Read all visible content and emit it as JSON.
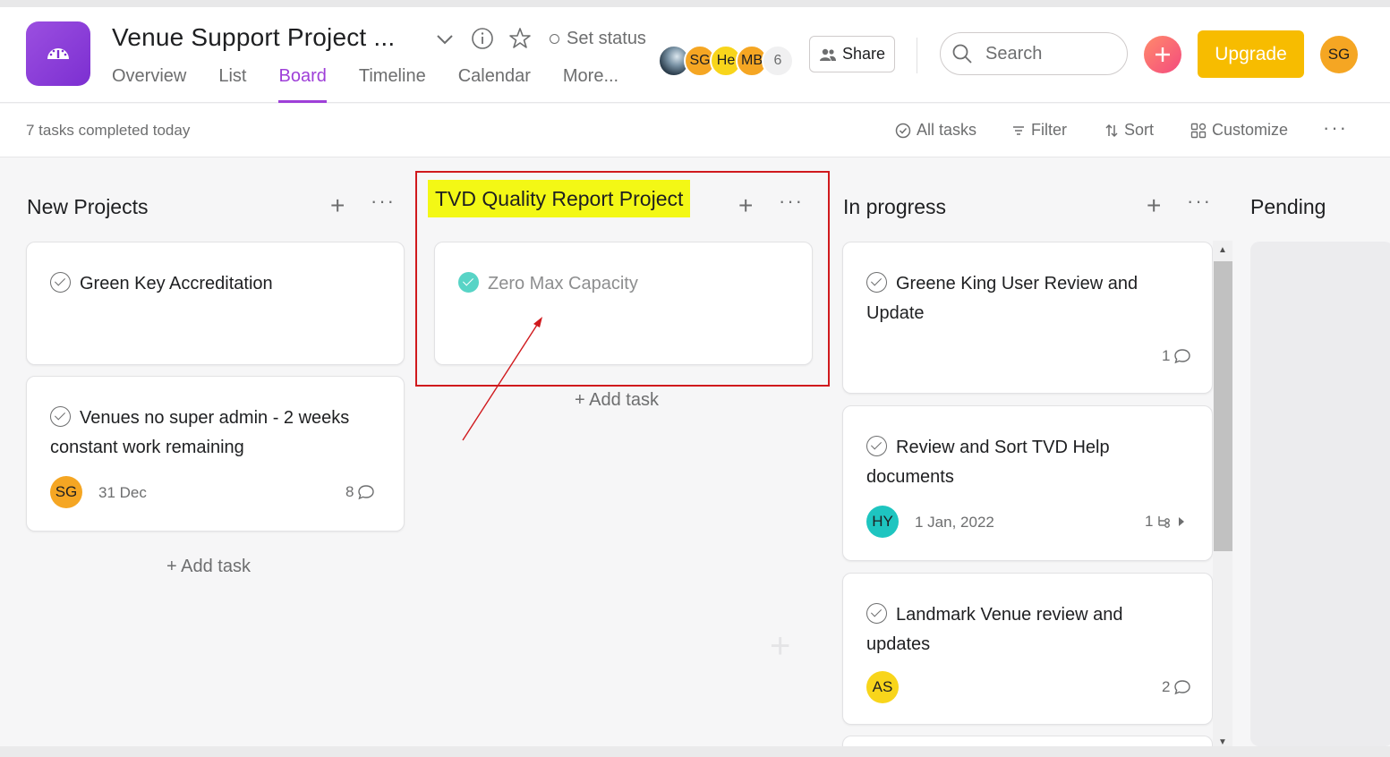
{
  "header": {
    "project_title": "Venue Support Project ...",
    "set_status": "Set status",
    "tabs": [
      "Overview",
      "List",
      "Board",
      "Timeline",
      "Calendar",
      "More..."
    ],
    "active_tab": "Board",
    "members": [
      {
        "initials": "",
        "kind": "photo"
      },
      {
        "initials": "SG"
      },
      {
        "initials": "He"
      },
      {
        "initials": "MB"
      }
    ],
    "member_count": "6",
    "share_label": "Share",
    "search_placeholder": "Search",
    "upgrade_label": "Upgrade",
    "user_initials": "SG"
  },
  "toolbar": {
    "completed_text": "7 tasks completed today",
    "all_tasks": "All tasks",
    "filter": "Filter",
    "sort": "Sort",
    "customize": "Customize"
  },
  "columns": [
    {
      "title": "New Projects",
      "cards": [
        {
          "title": "Green Key Accreditation"
        },
        {
          "title": "Venues no super admin - 2 weeks constant work remaining",
          "assignee": "SG",
          "due": "31 Dec",
          "comments": "8"
        }
      ],
      "add_task": "+ Add task"
    },
    {
      "title": "TVD Quality Report Project",
      "cards": [
        {
          "title": "Zero Max Capacity",
          "completed": true
        }
      ],
      "add_task": "+ Add task"
    },
    {
      "title": "In progress",
      "cards": [
        {
          "title": "Greene King User Review and Update",
          "comments": "1"
        },
        {
          "title": "Review and Sort TVD Help documents",
          "assignee": "HY",
          "due": "1 Jan, 2022",
          "subtasks": "1"
        },
        {
          "title": "Landmark Venue review and updates",
          "assignee": "AS",
          "comments": "2"
        }
      ]
    },
    {
      "title": "Pending",
      "cards": []
    }
  ],
  "colors": {
    "accent": "#9e3fd8",
    "upgrade": "#f7bc00",
    "highlight": "#f3f815",
    "annotation_red": "#d0191d"
  }
}
